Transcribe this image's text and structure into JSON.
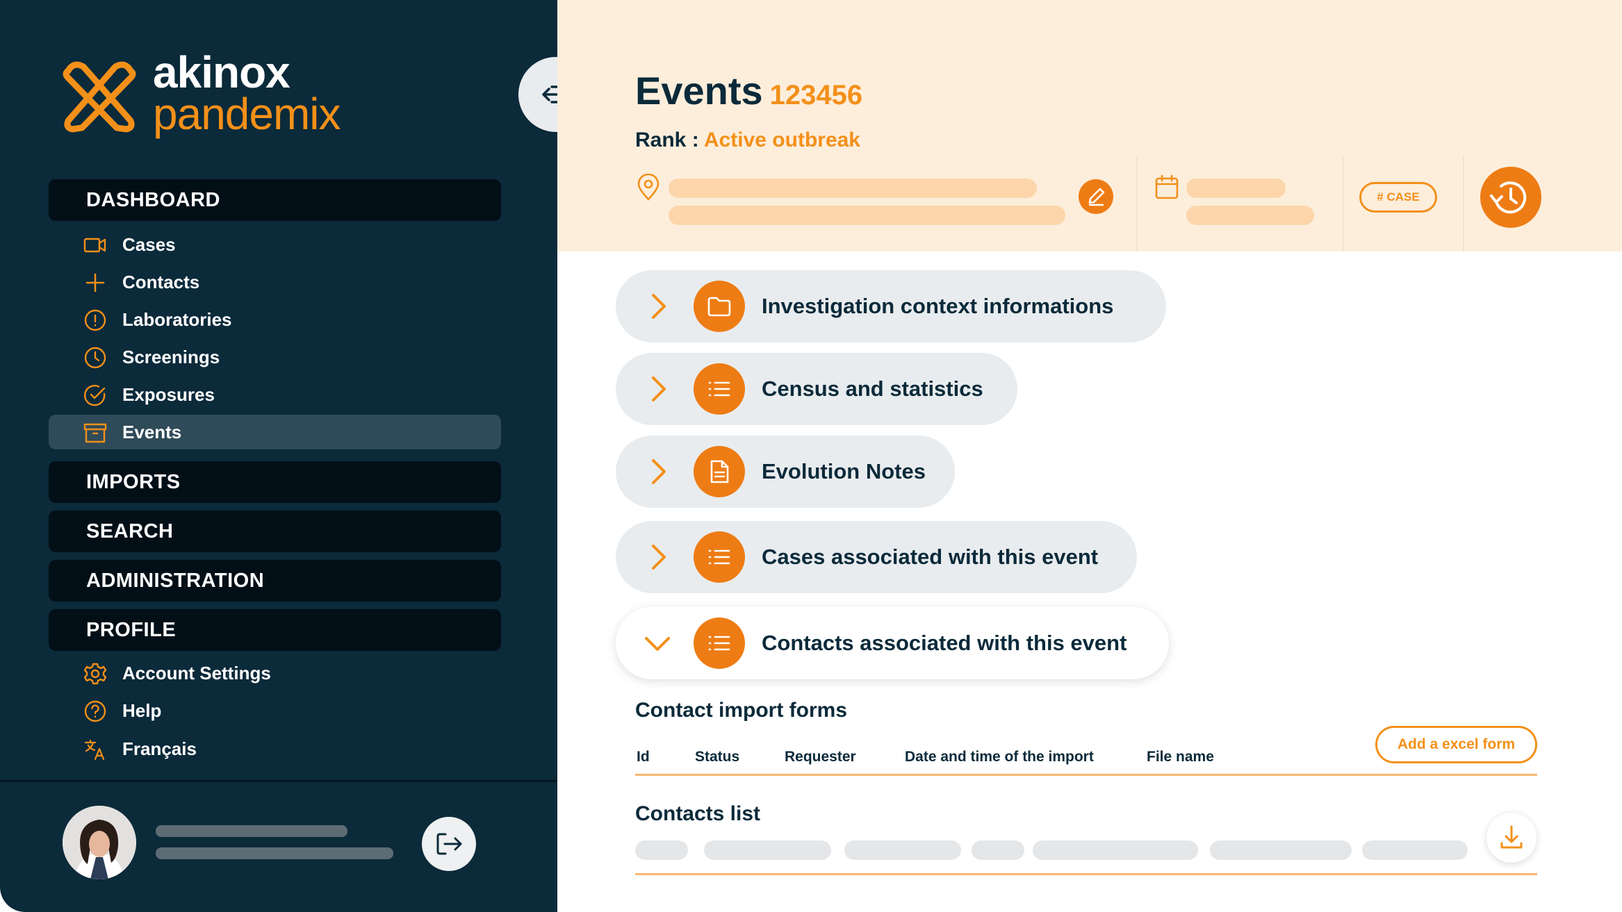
{
  "brand": {
    "line1": "akinox",
    "line2": "pandemix"
  },
  "sidebar": {
    "sections": {
      "dashboard": "DASHBOARD",
      "imports": "IMPORTS",
      "search": "SEARCH",
      "administration": "ADMINISTRATION",
      "profile": "PROFILE"
    },
    "dashboard_items": [
      {
        "label": "Cases",
        "icon": "video-icon"
      },
      {
        "label": "Contacts",
        "icon": "plus-icon"
      },
      {
        "label": "Laboratories",
        "icon": "alert-circle-icon"
      },
      {
        "label": "Screenings",
        "icon": "clock-icon"
      },
      {
        "label": "Exposures",
        "icon": "check-circle-icon"
      },
      {
        "label": "Events",
        "icon": "archive-icon",
        "active": true
      }
    ],
    "profile_items": [
      {
        "label": "Account Settings",
        "icon": "gear-icon"
      },
      {
        "label": "Help",
        "icon": "help-circle-icon"
      },
      {
        "label": "Français",
        "icon": "translate-icon"
      }
    ]
  },
  "header": {
    "title": "Events",
    "title_number": "123456",
    "rank_label": "Rank :",
    "rank_value": "Active outbreak",
    "case_badge": "# CASE"
  },
  "accordion": [
    {
      "label": "Investigation context informations",
      "icon": "folder-icon",
      "expanded": false
    },
    {
      "label": "Census and statistics",
      "icon": "list-icon",
      "expanded": false
    },
    {
      "label": "Evolution Notes",
      "icon": "document-icon",
      "expanded": false
    },
    {
      "label": "Cases associated with this event",
      "icon": "list-icon",
      "expanded": false
    },
    {
      "label": "Contacts associated with this event",
      "icon": "list-icon",
      "expanded": true
    }
  ],
  "contact_import": {
    "title": "Contact import forms",
    "columns": [
      "Id",
      "Status",
      "Requester",
      "Date and time of the import",
      "File name"
    ],
    "add_button": "Add a excel form"
  },
  "contacts_list": {
    "title": "Contacts list"
  },
  "colors": {
    "sidebar_bg": "#0b2a3a",
    "accent": "#f39019",
    "header_bg": "#fdeedc"
  }
}
